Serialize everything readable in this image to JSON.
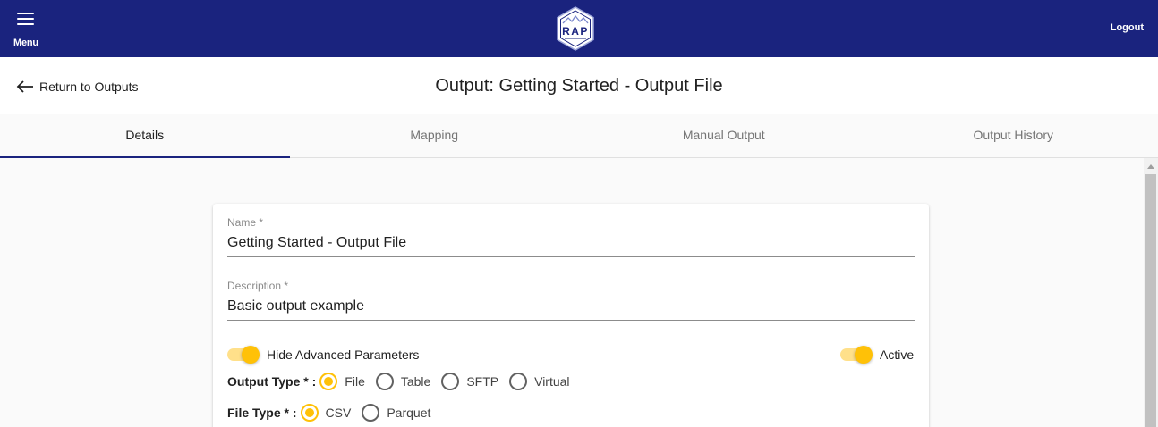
{
  "topbar": {
    "menu_label": "Menu",
    "logo_text": "RAP",
    "logout_label": "Logout",
    "bg_color": "#1a237e"
  },
  "header": {
    "back_label": "Return to Outputs",
    "title": "Output: Getting Started - Output File"
  },
  "tabs": [
    {
      "label": "Details",
      "active": true
    },
    {
      "label": "Mapping",
      "active": false
    },
    {
      "label": "Manual Output",
      "active": false
    },
    {
      "label": "Output History",
      "active": false
    }
  ],
  "form": {
    "name": {
      "label": "Name *",
      "value": "Getting Started - Output File"
    },
    "description": {
      "label": "Description *",
      "value": "Basic output example"
    },
    "hide_advanced": {
      "label": "Hide Advanced Parameters",
      "checked": true
    },
    "active": {
      "label": "Active",
      "checked": true
    },
    "output_type": {
      "label": "Output Type * :",
      "options": [
        "File",
        "Table",
        "SFTP",
        "Virtual"
      ],
      "selected": "File"
    },
    "file_type": {
      "label": "File Type * :",
      "options": [
        "CSV",
        "Parquet"
      ],
      "selected": "CSV"
    }
  },
  "colors": {
    "accent": "#ffc107",
    "primary": "#1a237e"
  }
}
